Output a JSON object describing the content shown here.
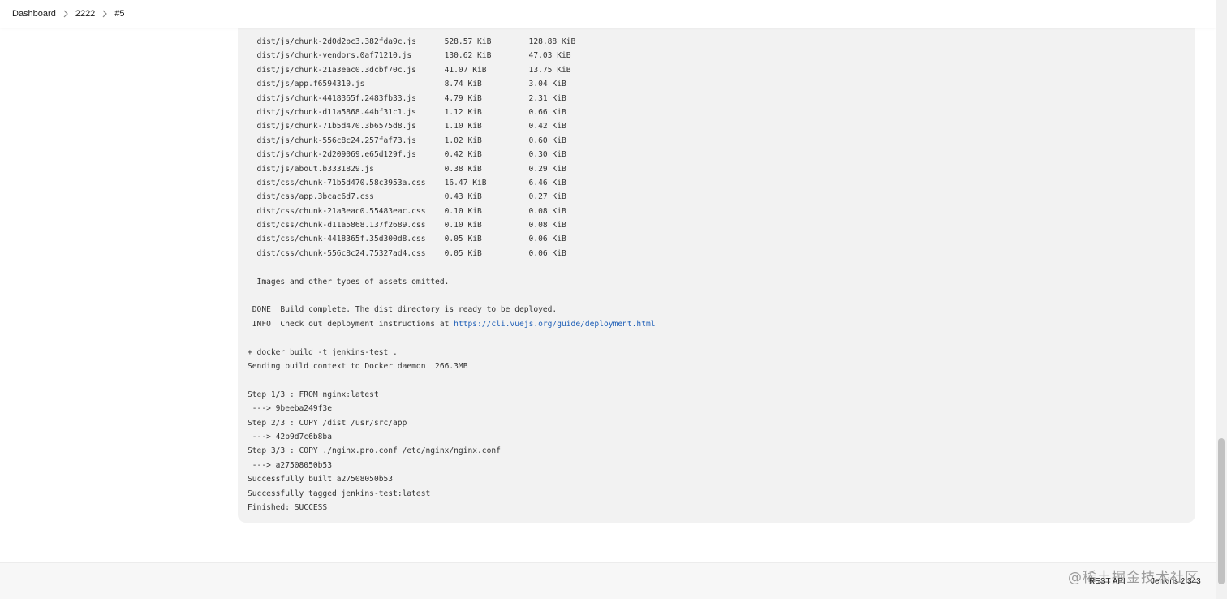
{
  "breadcrumb": {
    "items": [
      "Dashboard",
      "2222",
      "#5"
    ]
  },
  "console": {
    "lines": [
      "  dist/js/chunk-2d0d2bc3.382fda9c.js      528.57 KiB        128.88 KiB",
      "  dist/js/chunk-vendors.0af71210.js       130.62 KiB        47.03 KiB",
      "  dist/js/chunk-21a3eac0.3dcbf70c.js      41.07 KiB         13.75 KiB",
      "  dist/js/app.f6594310.js                 8.74 KiB          3.04 KiB",
      "  dist/js/chunk-4418365f.2483fb33.js      4.79 KiB          2.31 KiB",
      "  dist/js/chunk-d11a5868.44bf31c1.js      1.12 KiB          0.66 KiB",
      "  dist/js/chunk-71b5d470.3b6575d8.js      1.10 KiB          0.42 KiB",
      "  dist/js/chunk-556c8c24.257faf73.js      1.02 KiB          0.60 KiB",
      "  dist/js/chunk-2d209069.e65d129f.js      0.42 KiB          0.30 KiB",
      "  dist/js/about.b3331829.js               0.38 KiB          0.29 KiB",
      "  dist/css/chunk-71b5d470.58c3953a.css    16.47 KiB         6.46 KiB",
      "  dist/css/app.3bcac6d7.css               0.43 KiB          0.27 KiB",
      "  dist/css/chunk-21a3eac0.55483eac.css    0.10 KiB          0.08 KiB",
      "  dist/css/chunk-d11a5868.137f2689.css    0.10 KiB          0.08 KiB",
      "  dist/css/chunk-4418365f.35d300d8.css    0.05 KiB          0.06 KiB",
      "  dist/css/chunk-556c8c24.75327ad4.css    0.05 KiB          0.06 KiB",
      "",
      "  Images and other types of assets omitted.",
      "",
      " DONE  Build complete. The dist directory is ready to be deployed.",
      " INFO  Check out deployment instructions at ",
      "",
      "+ docker build -t jenkins-test .",
      "Sending build context to Docker daemon  266.3MB",
      "",
      "Step 1/3 : FROM nginx:latest",
      " ---> 9beeba249f3e",
      "Step 2/3 : COPY /dist /usr/src/app",
      " ---> 42b9d7c6b8ba",
      "Step 3/3 : COPY ./nginx.pro.conf /etc/nginx/nginx.conf",
      " ---> a27508050b53",
      "Successfully built a27508050b53",
      "Successfully tagged jenkins-test:latest",
      "Finished: SUCCESS"
    ],
    "link_line_index": 20,
    "link_text": "https://cli.vuejs.org/guide/deployment.html"
  },
  "footer": {
    "rest_api_label": "REST API",
    "version_label": "Jenkins 2.343"
  },
  "watermark": "@稀土掘金技术社区",
  "colors": {
    "link": "#1f5fb7",
    "console_bg": "#f2f2f2"
  }
}
